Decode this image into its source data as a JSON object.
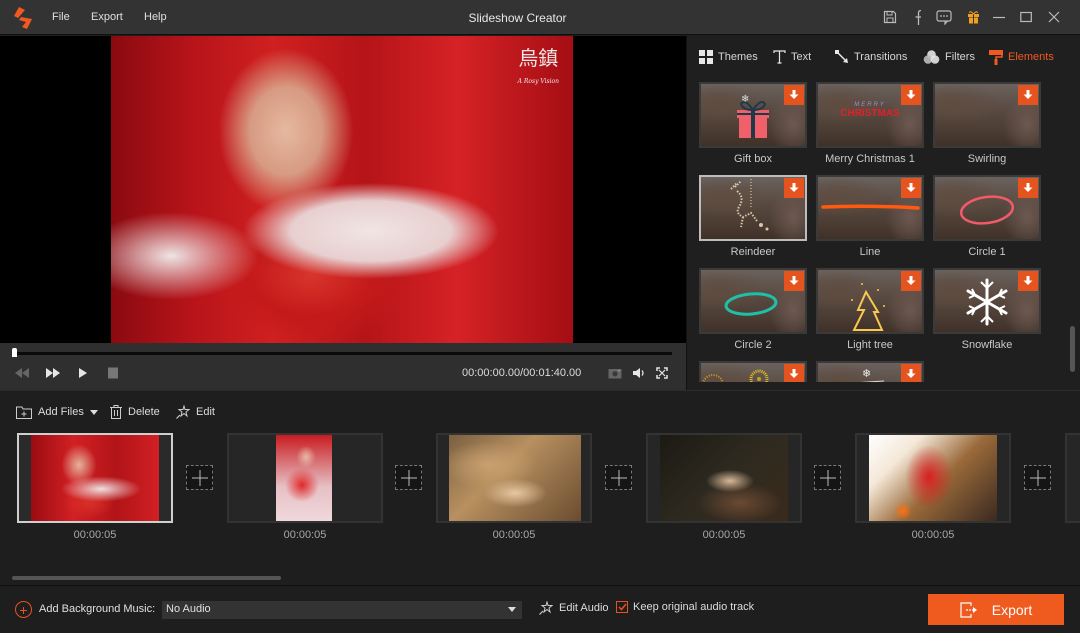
{
  "titlebar": {
    "app_title": "Slideshow Creator",
    "menu": [
      "File",
      "Export",
      "Help"
    ],
    "icons": [
      "save-icon",
      "facebook-icon",
      "feedback-icon",
      "gift-icon",
      "minimize-icon",
      "maximize-icon",
      "close-icon"
    ]
  },
  "colors": {
    "accent": "#ef5a1e",
    "gift_icon": "#f0a020",
    "panel_bg": "#1e1e1e",
    "titlebar_bg": "#333333"
  },
  "preview": {
    "watermark_text": "烏鎮",
    "watermark_sub": "A Rosy Vision",
    "playhead_fraction": 0.0
  },
  "player": {
    "timecode": "00:00:00.00/00:01:40.00",
    "controls": [
      "rewind",
      "fast-forward",
      "play",
      "stop",
      "snapshot",
      "volume",
      "fullscreen"
    ]
  },
  "right_panel": {
    "tabs": [
      {
        "label": "Themes",
        "icon": "grid-icon",
        "active": false
      },
      {
        "label": "Text",
        "icon": "text-icon",
        "active": false
      },
      {
        "label": "Transitions",
        "icon": "transitions-icon",
        "active": false
      },
      {
        "label": "Filters",
        "icon": "filters-icon",
        "active": false
      },
      {
        "label": "Elements",
        "icon": "paint-roller-icon",
        "active": true
      }
    ],
    "elements": [
      {
        "label": "Gift box",
        "selected": false
      },
      {
        "label": "Merry Christmas 1",
        "selected": false
      },
      {
        "label": "Swirling",
        "selected": false
      },
      {
        "label": "Reindeer",
        "selected": true
      },
      {
        "label": "Line",
        "selected": false
      },
      {
        "label": "Circle 1",
        "selected": false
      },
      {
        "label": "Circle 2",
        "selected": false
      },
      {
        "label": "Light tree",
        "selected": false
      },
      {
        "label": "Snowflake",
        "selected": false
      },
      {
        "label": "",
        "selected": false
      },
      {
        "label": "",
        "selected": false
      }
    ],
    "merry_christmas_art": {
      "top": "MERRY",
      "main": "CHRISTMAS"
    }
  },
  "toolbar": {
    "add_files": "Add Files",
    "delete": "Delete",
    "edit": "Edit"
  },
  "timeline": {
    "clips": [
      {
        "duration": "00:00:05",
        "selected": true
      },
      {
        "duration": "00:00:05",
        "selected": false
      },
      {
        "duration": "00:00:05",
        "selected": false
      },
      {
        "duration": "00:00:05",
        "selected": false
      },
      {
        "duration": "00:00:05",
        "selected": false
      }
    ]
  },
  "bottom": {
    "add_bg_music_label": "Add Background Music:",
    "audio_select_value": "No Audio",
    "edit_audio": "Edit Audio",
    "keep_original_audio": "Keep original audio track",
    "keep_original_checked": true,
    "export_label": "Export"
  }
}
